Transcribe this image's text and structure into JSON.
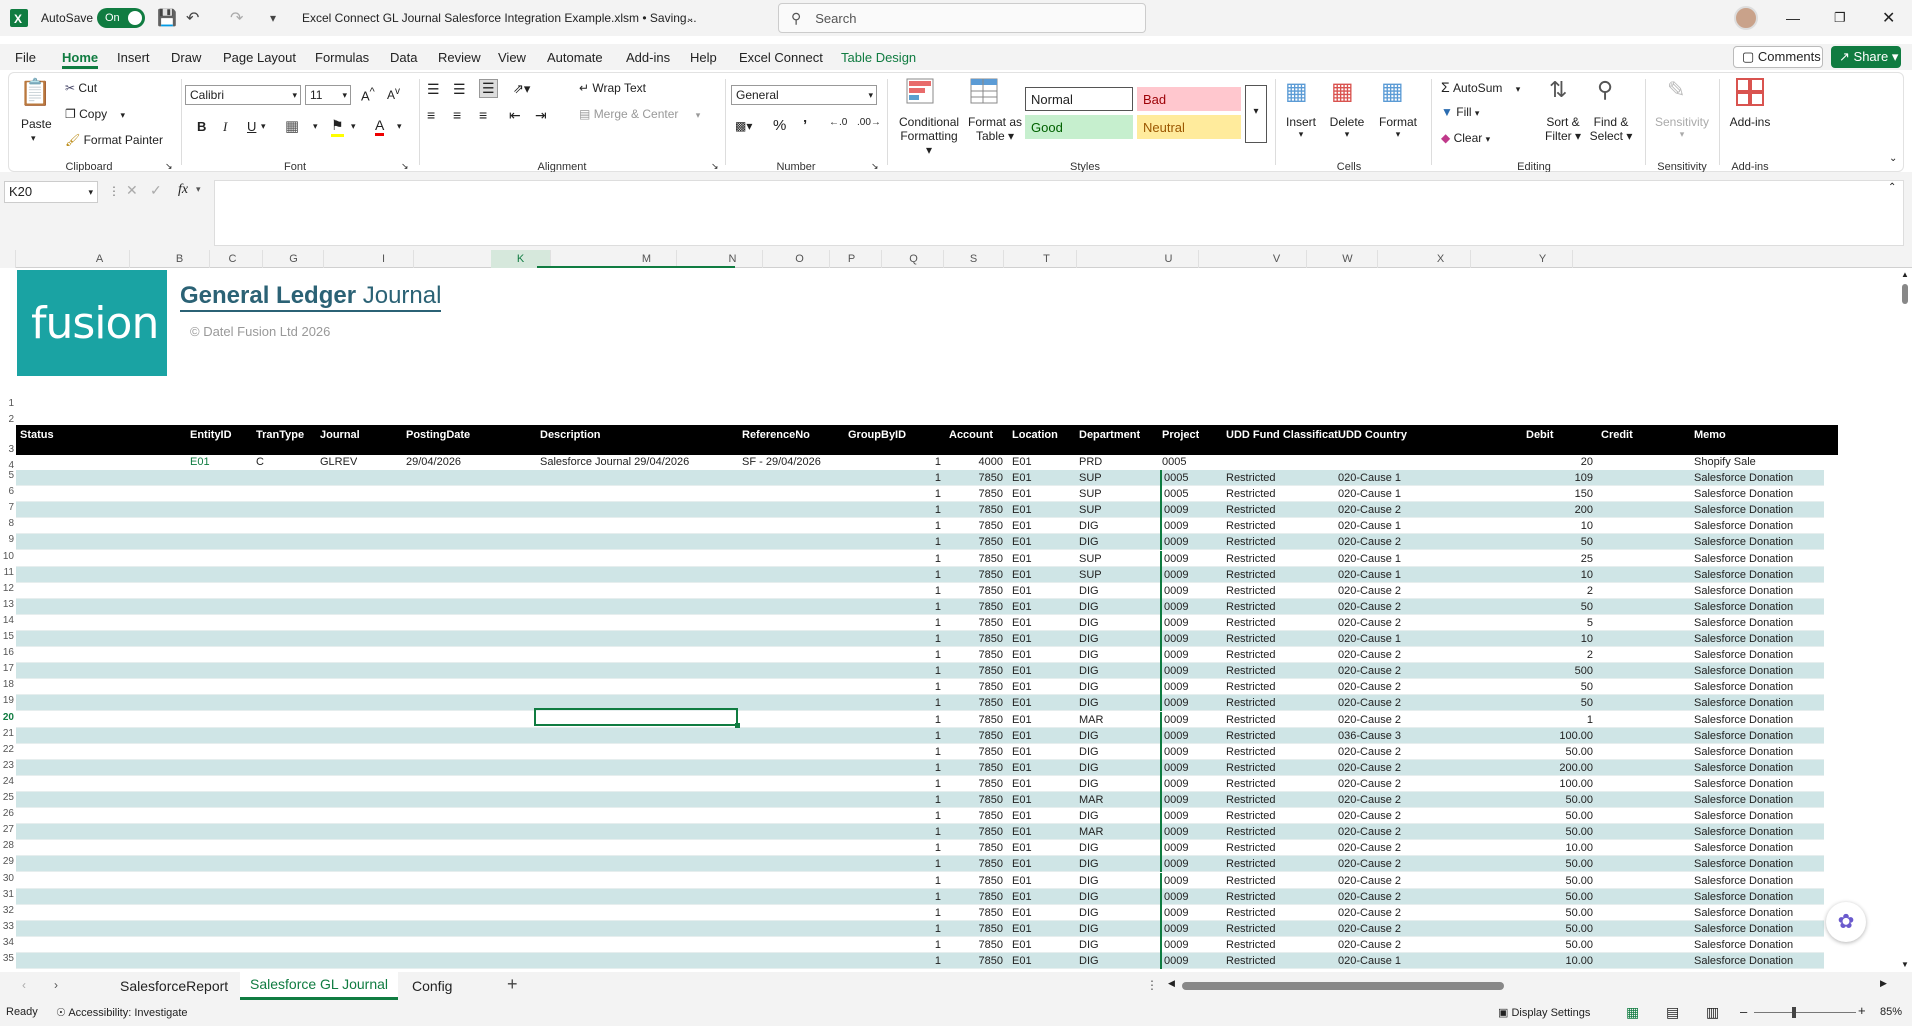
{
  "title": {
    "autosave_label": "AutoSave",
    "autosave_state": "On",
    "filename": "Excel Connect GL Journal Salesforce Integration Example.xlsm • Saving...",
    "search_placeholder": "Search"
  },
  "menu": [
    "File",
    "Home",
    "Insert",
    "Draw",
    "Page Layout",
    "Formulas",
    "Data",
    "Review",
    "View",
    "Automate",
    "Add-ins",
    "Help",
    "Excel Connect",
    "Table Design"
  ],
  "menu_right": {
    "comments": "Comments",
    "share": "Share"
  },
  "ribbon": {
    "paste": "Paste",
    "cut": "Cut",
    "copy": "Copy",
    "format_painter": "Format Painter",
    "clipboard": "Clipboard",
    "font_name": "Calibri",
    "font_size": "11",
    "font": "Font",
    "wrap_text": "Wrap Text",
    "merge_center": "Merge & Center",
    "alignment": "Alignment",
    "number_format": "General",
    "number": "Number",
    "cond_fmt_1": "Conditional",
    "cond_fmt_2": "Formatting",
    "fmt_table_1": "Format as",
    "fmt_table_2": "Table",
    "style_normal": "Normal",
    "style_bad": "Bad",
    "style_good": "Good",
    "style_neutral": "Neutral",
    "styles": "Styles",
    "insert": "Insert",
    "delete": "Delete",
    "format": "Format",
    "cells": "Cells",
    "autosum": "AutoSum",
    "fill": "Fill",
    "clear": "Clear",
    "sort_1": "Sort &",
    "sort_2": "Filter",
    "find_1": "Find &",
    "find_2": "Select",
    "editing": "Editing",
    "sensitivity": "Sensitivity",
    "addins": "Add-ins"
  },
  "namebox": "K20",
  "fx": "fx",
  "columns": [
    [
      "A",
      100
    ],
    [
      "B",
      180
    ],
    [
      "C",
      233
    ],
    [
      "G",
      294
    ],
    [
      "I",
      384
    ],
    [
      "K",
      521
    ],
    [
      "M",
      647
    ],
    [
      "N",
      733
    ],
    [
      "O",
      800
    ],
    [
      "P",
      852
    ],
    [
      "Q",
      914
    ],
    [
      "S",
      974
    ],
    [
      "T",
      1047
    ],
    [
      "U",
      1169
    ],
    [
      "V",
      1277
    ],
    [
      "W",
      1348
    ],
    [
      "X",
      1441
    ],
    [
      "Y",
      1543
    ]
  ],
  "logo_text": "fusion",
  "journal_title_bold": "General Ledger",
  "journal_title_rest": " Journal",
  "copyright": "© Datel Fusion Ltd 2026",
  "table_headers": [
    "Status",
    "EntityID",
    "TranType",
    "Journal",
    "PostingDate",
    "Description",
    "ReferenceNo",
    "GroupByID",
    "Account",
    "Location",
    "Department",
    "Project",
    "UDD Fund Classificati",
    "UDD Country",
    "Debit",
    "Credit",
    "Memo"
  ],
  "row4": {
    "entity": "E01",
    "trantype": "C",
    "journal": "GLREV",
    "date": "29/04/2026",
    "desc": "Salesforce Journal 29/04/2026",
    "ref": "SF - 29/04/2026",
    "group": "1",
    "account": "4000",
    "loc": "E01",
    "dept": "PRD",
    "project": "0005",
    "fund": "",
    "country": "",
    "debit": "20",
    "memo": "Shopify Sale"
  },
  "rows": [
    [
      "1",
      "7850",
      "E01",
      "SUP",
      "0005",
      "Restricted",
      "020-Cause 1",
      "109",
      "Salesforce Donation"
    ],
    [
      "1",
      "7850",
      "E01",
      "SUP",
      "0005",
      "Restricted",
      "020-Cause 1",
      "150",
      "Salesforce Donation"
    ],
    [
      "1",
      "7850",
      "E01",
      "SUP",
      "0009",
      "Restricted",
      "020-Cause 2",
      "200",
      "Salesforce Donation"
    ],
    [
      "1",
      "7850",
      "E01",
      "DIG",
      "0009",
      "Restricted",
      "020-Cause 1",
      "10",
      "Salesforce Donation"
    ],
    [
      "1",
      "7850",
      "E01",
      "DIG",
      "0009",
      "Restricted",
      "020-Cause 2",
      "50",
      "Salesforce Donation"
    ],
    [
      "1",
      "7850",
      "E01",
      "SUP",
      "0009",
      "Restricted",
      "020-Cause 1",
      "25",
      "Salesforce Donation"
    ],
    [
      "1",
      "7850",
      "E01",
      "SUP",
      "0009",
      "Restricted",
      "020-Cause 1",
      "10",
      "Salesforce Donation"
    ],
    [
      "1",
      "7850",
      "E01",
      "DIG",
      "0009",
      "Restricted",
      "020-Cause 2",
      "2",
      "Salesforce Donation"
    ],
    [
      "1",
      "7850",
      "E01",
      "DIG",
      "0009",
      "Restricted",
      "020-Cause 2",
      "50",
      "Salesforce Donation"
    ],
    [
      "1",
      "7850",
      "E01",
      "DIG",
      "0009",
      "Restricted",
      "020-Cause 2",
      "5",
      "Salesforce Donation"
    ],
    [
      "1",
      "7850",
      "E01",
      "DIG",
      "0009",
      "Restricted",
      "020-Cause 1",
      "10",
      "Salesforce Donation"
    ],
    [
      "1",
      "7850",
      "E01",
      "DIG",
      "0009",
      "Restricted",
      "020-Cause 2",
      "2",
      "Salesforce Donation"
    ],
    [
      "1",
      "7850",
      "E01",
      "DIG",
      "0009",
      "Restricted",
      "020-Cause 2",
      "500",
      "Salesforce Donation"
    ],
    [
      "1",
      "7850",
      "E01",
      "DIG",
      "0009",
      "Restricted",
      "020-Cause 2",
      "50",
      "Salesforce Donation"
    ],
    [
      "1",
      "7850",
      "E01",
      "DIG",
      "0009",
      "Restricted",
      "020-Cause 2",
      "50",
      "Salesforce Donation"
    ],
    [
      "1",
      "7850",
      "E01",
      "MAR",
      "0009",
      "Restricted",
      "020-Cause 2",
      "1",
      "Salesforce Donation"
    ],
    [
      "1",
      "7850",
      "E01",
      "DIG",
      "0009",
      "Restricted",
      "036-Cause 3",
      "100.00",
      "Salesforce Donation"
    ],
    [
      "1",
      "7850",
      "E01",
      "DIG",
      "0009",
      "Restricted",
      "020-Cause 2",
      "50.00",
      "Salesforce Donation"
    ],
    [
      "1",
      "7850",
      "E01",
      "DIG",
      "0009",
      "Restricted",
      "020-Cause 2",
      "200.00",
      "Salesforce Donation"
    ],
    [
      "1",
      "7850",
      "E01",
      "DIG",
      "0009",
      "Restricted",
      "020-Cause 2",
      "100.00",
      "Salesforce Donation"
    ],
    [
      "1",
      "7850",
      "E01",
      "MAR",
      "0009",
      "Restricted",
      "020-Cause 2",
      "50.00",
      "Salesforce Donation"
    ],
    [
      "1",
      "7850",
      "E01",
      "DIG",
      "0009",
      "Restricted",
      "020-Cause 2",
      "50.00",
      "Salesforce Donation"
    ],
    [
      "1",
      "7850",
      "E01",
      "MAR",
      "0009",
      "Restricted",
      "020-Cause 2",
      "50.00",
      "Salesforce Donation"
    ],
    [
      "1",
      "7850",
      "E01",
      "DIG",
      "0009",
      "Restricted",
      "020-Cause 2",
      "10.00",
      "Salesforce Donation"
    ],
    [
      "1",
      "7850",
      "E01",
      "DIG",
      "0009",
      "Restricted",
      "020-Cause 2",
      "50.00",
      "Salesforce Donation"
    ],
    [
      "1",
      "7850",
      "E01",
      "DIG",
      "0009",
      "Restricted",
      "020-Cause 2",
      "50.00",
      "Salesforce Donation"
    ],
    [
      "1",
      "7850",
      "E01",
      "DIG",
      "0009",
      "Restricted",
      "020-Cause 2",
      "50.00",
      "Salesforce Donation"
    ],
    [
      "1",
      "7850",
      "E01",
      "DIG",
      "0009",
      "Restricted",
      "020-Cause 2",
      "50.00",
      "Salesforce Donation"
    ],
    [
      "1",
      "7850",
      "E01",
      "DIG",
      "0009",
      "Restricted",
      "020-Cause 2",
      "50.00",
      "Salesforce Donation"
    ],
    [
      "1",
      "7850",
      "E01",
      "DIG",
      "0009",
      "Restricted",
      "020-Cause 2",
      "50.00",
      "Salesforce Donation"
    ],
    [
      "1",
      "7850",
      "E01",
      "DIG",
      "0009",
      "Restricted",
      "020-Cause 1",
      "10.00",
      "Salesforce Donation"
    ]
  ],
  "sheet_tabs": [
    "SalesforceReport",
    "Salesforce GL Journal",
    "Config"
  ],
  "status": {
    "ready": "Ready",
    "accessibility": "Accessibility: Investigate",
    "display": "Display Settings",
    "zoom": "85%"
  },
  "colors": {
    "accent": "#107c41",
    "teal": "#1aa3a3",
    "band": "#cfe5e6"
  }
}
